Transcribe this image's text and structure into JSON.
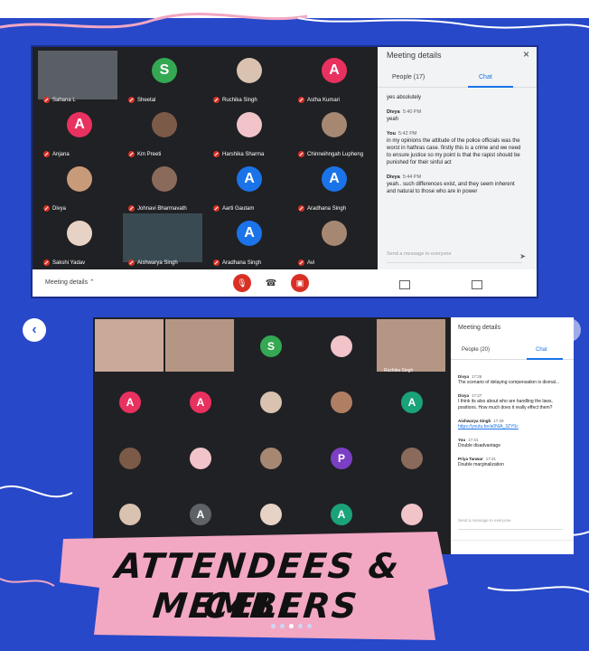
{
  "colors": {
    "background": "#2748c9",
    "meet_dark": "#202124",
    "accent_blue": "#1a73e8",
    "muted_red": "#d93025",
    "banner_pink": "#f2a7c3"
  },
  "shot1": {
    "participants": [
      {
        "name": "Sahana L",
        "type": "video"
      },
      {
        "name": "Sheetal",
        "type": "avatar",
        "letter": "S",
        "color": "#34a853"
      },
      {
        "name": "Ruchika Singh",
        "type": "photo"
      },
      {
        "name": "Astha Kumari",
        "type": "avatar",
        "letter": "A",
        "color": "#e8315f"
      },
      {
        "name": "Anjana",
        "type": "avatar",
        "letter": "A",
        "color": "#e8315f"
      },
      {
        "name": "Km Preeti",
        "type": "photo"
      },
      {
        "name": "Harshika Sharma",
        "type": "photo"
      },
      {
        "name": "Chinneihngah Lupheng",
        "type": "photo"
      },
      {
        "name": "Divya",
        "type": "photo"
      },
      {
        "name": "Johnavi Bharmavath",
        "type": "photo"
      },
      {
        "name": "Aarti Gautam",
        "type": "avatar",
        "letter": "A",
        "color": "#1a73e8"
      },
      {
        "name": "Aradhana Singh",
        "type": "avatar",
        "letter": "A",
        "color": "#1a73e8"
      },
      {
        "name": "Sakshi Yadav",
        "type": "photo"
      },
      {
        "name": "Aishwarya Singh",
        "type": "video"
      },
      {
        "name": "Aradhana Singh",
        "type": "avatar",
        "letter": "A",
        "color": "#1a73e8"
      },
      {
        "name": "Avi",
        "type": "photo"
      }
    ],
    "panel": {
      "title": "Meeting details",
      "close_icon": "×",
      "people_tab": "People (17)",
      "chat_tab": "Chat",
      "messages": [
        {
          "sender": "",
          "time": "",
          "text": "yes absolutely"
        },
        {
          "sender": "Divya",
          "time": "5:40 PM",
          "text": "yeah"
        },
        {
          "sender": "You",
          "time": "5:42 PM",
          "text": "in my opinions the attitude of the police officials was the worst in hathras case. firstly this is a crime and we need to ensure justice so my point is that the rapist should be punished for their sinful act"
        },
        {
          "sender": "Divya",
          "time": "5:44 PM",
          "text": "yeah.. such differences exist, and they seem inherent and natural to those who are in power"
        }
      ],
      "input_placeholder": "Send a message to everyone"
    },
    "bottom_bar": {
      "meeting_details": "Meeting details",
      "caret": "⌃"
    }
  },
  "shot2": {
    "participants": [
      {
        "name": "",
        "type": "video"
      },
      {
        "name": "",
        "type": "video"
      },
      {
        "name": "",
        "type": "avatar",
        "letter": "S",
        "color": "#34a853"
      },
      {
        "name": "",
        "type": "photo"
      },
      {
        "name": "Ruchika Singh",
        "type": "video"
      },
      {
        "name": "",
        "type": "avatar",
        "letter": "A",
        "color": "#e8315f"
      },
      {
        "name": "",
        "type": "avatar",
        "letter": "A",
        "color": "#e8315f"
      },
      {
        "name": "",
        "type": "photo"
      },
      {
        "name": "",
        "type": "photo"
      },
      {
        "name": "",
        "type": "avatar",
        "letter": "A",
        "color": "#1aa37a"
      },
      {
        "name": "",
        "type": "photo"
      },
      {
        "name": "",
        "type": "photo"
      },
      {
        "name": "",
        "type": "photo"
      },
      {
        "name": "",
        "type": "avatar",
        "letter": "P",
        "color": "#7b3fc4"
      },
      {
        "name": "",
        "type": "photo"
      },
      {
        "name": "",
        "type": "photo"
      },
      {
        "name": "",
        "type": "avatar",
        "letter": "A",
        "color": "#5f6368"
      },
      {
        "name": "",
        "type": "photo"
      },
      {
        "name": "",
        "type": "avatar",
        "letter": "A",
        "color": "#1aa37a"
      },
      {
        "name": "",
        "type": "photo"
      }
    ],
    "panel": {
      "title": "Meeting details",
      "people_tab": "People (20)",
      "chat_tab": "Chat",
      "messages": [
        {
          "sender": "Divya",
          "time": "17:26",
          "text": "The scenario of delaying compensation is dismal..."
        },
        {
          "sender": "Divya",
          "time": "17:27",
          "text": "I think its also about who are handling the laws, positions. How much does it really effect them?"
        },
        {
          "sender": "Aishwarya Singh",
          "time": "17:29",
          "text": "https://youtu.be/a0NIA_3ZY0c",
          "is_link": true
        },
        {
          "sender": "You",
          "time": "17:31",
          "text": "Double disadvantage"
        },
        {
          "sender": "Priya Tanwar",
          "time": "17:31",
          "text": "Double marginalization"
        }
      ],
      "input_placeholder": "Send a message to everyone"
    }
  },
  "nav": {
    "prev_icon": "‹",
    "next_icon": "›"
  },
  "banner": {
    "line1": "ATTENDEES & CELL",
    "line2": "MEMBERS"
  },
  "carousel": {
    "count": 5,
    "active": 2
  }
}
